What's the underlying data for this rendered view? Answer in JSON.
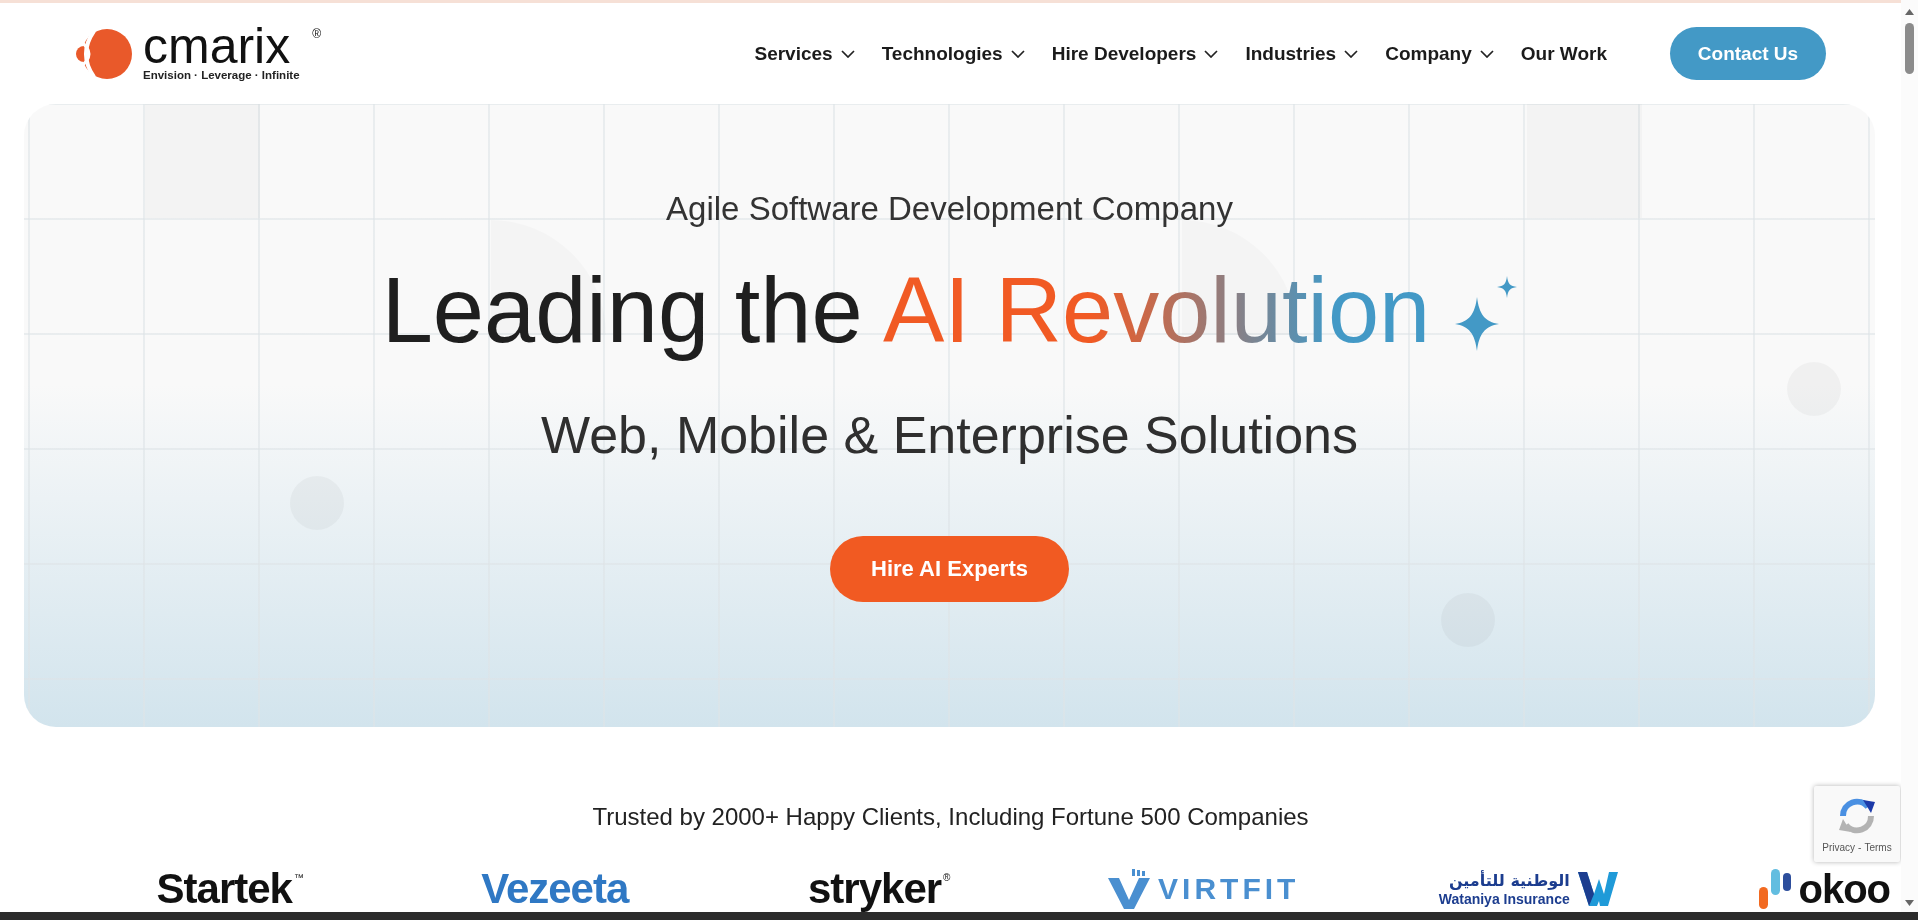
{
  "header": {
    "logo": {
      "name": "cmarix",
      "mark": "®",
      "tagline": "Envision · Leverage · Infinite"
    },
    "nav": [
      {
        "label": "Services",
        "dropdown": true
      },
      {
        "label": "Technologies",
        "dropdown": true
      },
      {
        "label": "Hire Developers",
        "dropdown": true
      },
      {
        "label": "Industries",
        "dropdown": true
      },
      {
        "label": "Company",
        "dropdown": true
      },
      {
        "label": "Our Work",
        "dropdown": false
      }
    ],
    "cta": "Contact Us"
  },
  "hero": {
    "eyebrow": "Agile Software Development Company",
    "heading": {
      "lead": "Leading the",
      "highlight": "AI Revolution"
    },
    "subheading": "Web, Mobile & Enterprise Solutions",
    "button": "Hire AI Experts"
  },
  "clients": {
    "title": "Trusted by 2000+ Happy Clients, Including Fortune 500 Companies",
    "logos": [
      {
        "kind": "wordmark",
        "text": "Startek",
        "mark": "™",
        "color": "#111111"
      },
      {
        "kind": "wordmark",
        "text": "Vezeeta",
        "color": "#2f78c4"
      },
      {
        "kind": "wordmark",
        "text": "stryker",
        "mark": "®",
        "color": "#111111"
      },
      {
        "kind": "chevron",
        "text": "VIRTFIT",
        "color": "#4a8fd0"
      },
      {
        "kind": "bilingual",
        "native": "الوطنية للتأمين",
        "text": "Wataniya Insurance",
        "color": "#1c3d8f"
      },
      {
        "kind": "bars",
        "text": "okoo",
        "color": "#111111"
      }
    ]
  },
  "recaptcha": {
    "links": [
      "Privacy",
      "Terms"
    ],
    "separator": "-"
  }
}
